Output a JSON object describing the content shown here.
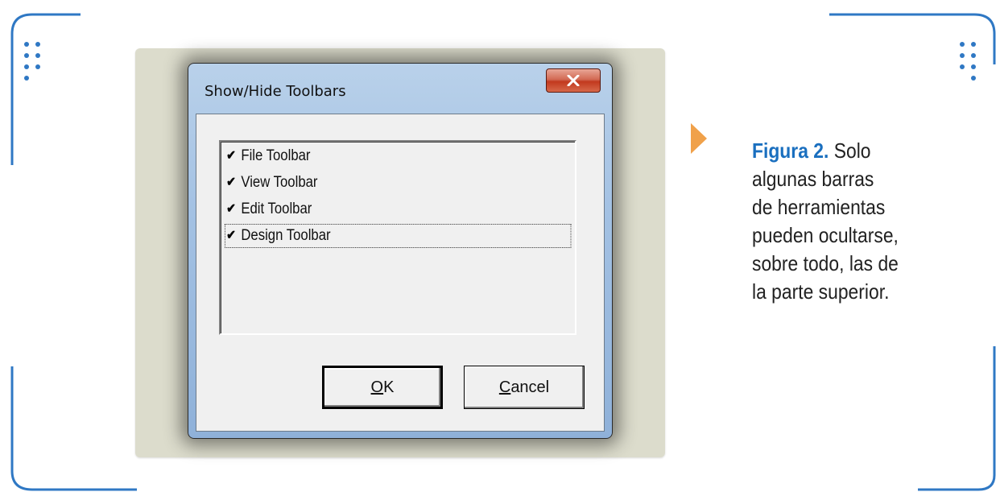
{
  "dialog": {
    "title": "Show/Hide Toolbars",
    "close_icon": "x-icon",
    "items": [
      {
        "label": "File Toolbar",
        "checked": true
      },
      {
        "label": "View Toolbar",
        "checked": true
      },
      {
        "label": "Edit Toolbar",
        "checked": true
      },
      {
        "label": "Design Toolbar",
        "checked": true
      }
    ],
    "ok_label": "OK",
    "ok_mnemonic": "O",
    "ok_rest": "K",
    "cancel_mnemonic": "C",
    "cancel_rest": "ancel",
    "check_glyph": "✔"
  },
  "caption": {
    "figure_label": "Figura 2.",
    "lines": [
      "Solo",
      "algunas barras",
      "de herramientas",
      "pueden ocultarse,",
      "sobre todo, las de",
      "la parte superior."
    ]
  },
  "colors": {
    "accent_blue": "#2f78c4",
    "arrow_orange": "#f0a14a",
    "panel_bg": "#dcdccc",
    "close_red": "#c2391e"
  }
}
